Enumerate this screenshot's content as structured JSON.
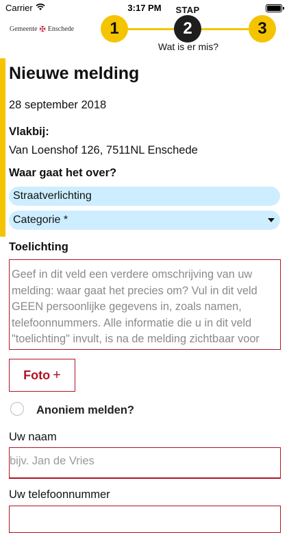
{
  "status_bar": {
    "carrier": "Carrier",
    "time": "3:17 PM"
  },
  "header": {
    "logo_text": "Gemeente",
    "logo_city": "Enschede",
    "stepper": {
      "stap_label": "STAP",
      "steps": [
        "1",
        "2",
        "3"
      ],
      "active_step": 2,
      "caption": "Wat is er mis?"
    }
  },
  "form": {
    "title": "Nieuwe melding",
    "date": "28 september 2018",
    "near_label": "Vlakbij:",
    "address": "Van Loenshof 126, 7511NL Enschede",
    "about_label": "Waar gaat het over?",
    "topic_value": "Straatverlichting",
    "category_value": "Categorie *",
    "explanation_label": "Toelichting",
    "explanation_placeholder": "Geef in dit veld een verdere omschrijving van uw melding: waar gaat het precies om? Vul in dit veld GEEN persoonlijke gegevens in, zoals namen, telefoonnummers. Alle informatie die u in dit veld \"toelichting\" invult, is na de melding zichtbaar voor",
    "photo_button": "Foto",
    "photo_plus": "+",
    "anonymous_label": "Anoniem melden?",
    "name_label": "Uw naam",
    "name_placeholder": "bijv. Jan de Vries",
    "phone_label": "Uw telefoonnummer"
  },
  "colors": {
    "accent_yellow": "#f5c400",
    "brand_red": "#b11226",
    "pill_blue": "#cdeeff",
    "active_step": "#1e1e1e"
  }
}
